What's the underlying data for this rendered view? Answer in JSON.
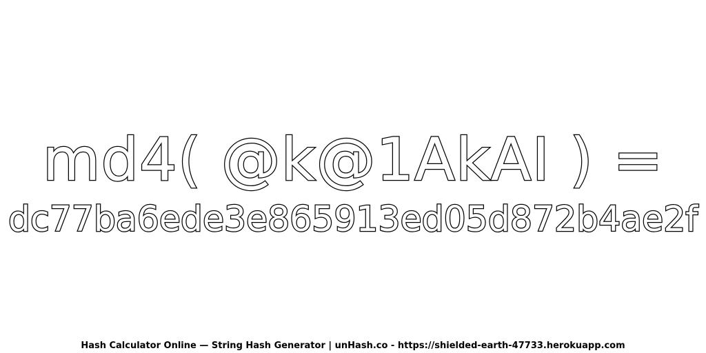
{
  "expression": "md4( @k@1AkAI ) =",
  "hash": "dc77ba6ede3e865913ed05d872b4ae2f",
  "footer": "Hash Calculator Online — String Hash Generator | unHash.co - https://shielded-earth-47733.herokuapp.com",
  "colors": {
    "background": "#ffffff",
    "text_fill": "#ffffff",
    "text_outline": "#000000"
  }
}
